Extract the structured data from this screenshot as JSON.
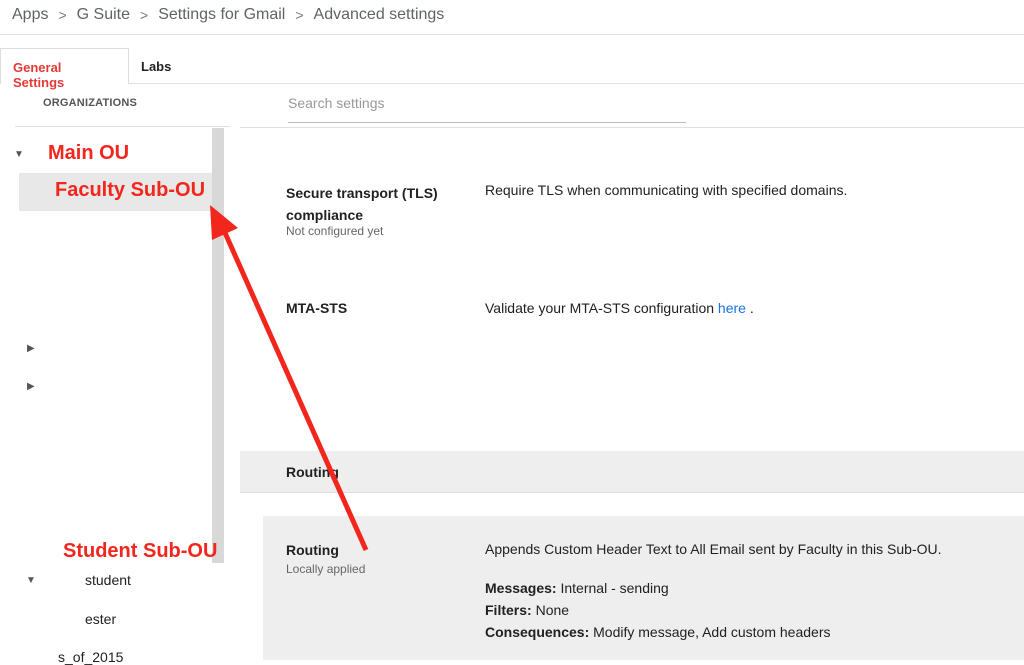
{
  "breadcrumb": [
    "Apps",
    "G Suite",
    "Settings for Gmail",
    "Advanced settings"
  ],
  "tabs": [
    {
      "label": "General Settings",
      "active": true
    },
    {
      "label": "Labs"
    }
  ],
  "sidebar": {
    "heading": "ORGANIZATIONS",
    "items": [
      "student",
      "ester",
      "s_of_2015"
    ]
  },
  "search": {
    "placeholder": "Search settings"
  },
  "annotations": {
    "main": "Main OU",
    "faculty": "Faculty Sub-OU",
    "student": "Student Sub-OU",
    "color": "#f2261c"
  },
  "settings": {
    "tls": {
      "title": "Secure transport (TLS) compliance",
      "status": "Not configured yet",
      "desc": "Require TLS when communicating with specified domains."
    },
    "mta": {
      "title": "MTA-STS",
      "desc": "Validate your MTA-STS configuration",
      "link": "here",
      "after": "."
    },
    "routing_section": "Routing",
    "routing": {
      "title": "Routing",
      "status": "Locally applied",
      "desc": "Appends Custom Header Text to All Email sent by Faculty in this Sub-OU.",
      "details": [
        {
          "k": "Messages:",
          "v": "Internal - sending"
        },
        {
          "k": "Filters:",
          "v": "None"
        },
        {
          "k": "Consequences:",
          "v": "Modify message, Add custom headers"
        }
      ]
    }
  }
}
